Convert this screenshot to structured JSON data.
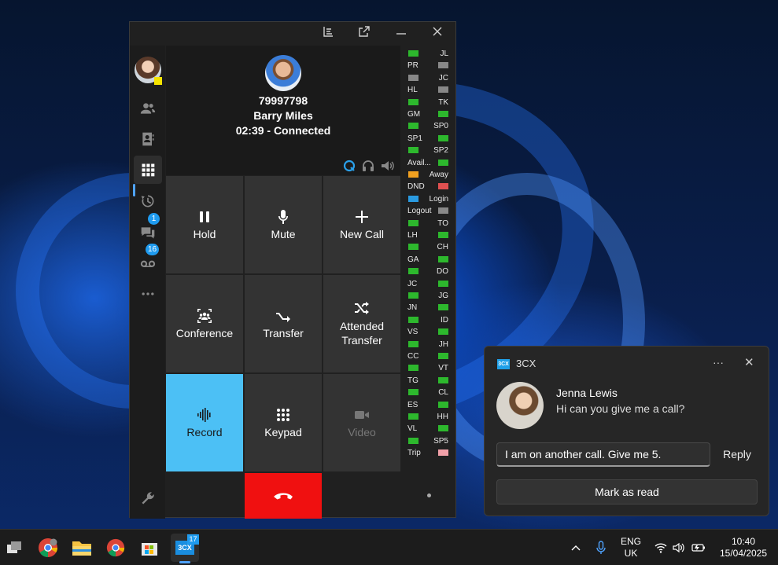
{
  "app": {
    "name": "3CX"
  },
  "call": {
    "number": "79997798",
    "name": "Barry Miles",
    "status": "02:39 - Connected"
  },
  "keys": [
    {
      "label": "Hold",
      "icon": "pause-icon"
    },
    {
      "label": "Mute",
      "icon": "microphone-icon"
    },
    {
      "label": "New Call",
      "icon": "plus-icon"
    },
    {
      "label": "Conference",
      "icon": "conference-icon"
    },
    {
      "label": "Transfer",
      "icon": "transfer-icon"
    },
    {
      "label": "Attended Transfer",
      "icon": "shuffle-icon"
    },
    {
      "label": "Record",
      "icon": "waveform-icon",
      "active": true
    },
    {
      "label": "Keypad",
      "icon": "keypad-icon"
    },
    {
      "label": "Video",
      "icon": "video-icon",
      "disabled": true
    }
  ],
  "sidebar": {
    "chat_badge": "1",
    "voicemail_badge": "16"
  },
  "blf": [
    {
      "label": "JL",
      "side": "right",
      "color": "#2db82d"
    },
    {
      "label": "PR",
      "side": "left",
      "color": "#888888"
    },
    {
      "label": "JC",
      "side": "right",
      "color": "#888888"
    },
    {
      "label": "HL",
      "side": "left",
      "color": "#888888"
    },
    {
      "label": "TK",
      "side": "right",
      "color": "#2db82d"
    },
    {
      "label": "GM",
      "side": "left",
      "color": "#2db82d"
    },
    {
      "label": "SP0",
      "side": "right",
      "color": "#2db82d"
    },
    {
      "label": "SP1",
      "side": "left",
      "color": "#2db82d"
    },
    {
      "label": "SP2",
      "side": "right",
      "color": "#2db82d"
    },
    {
      "label": "Avail...",
      "side": "left",
      "color": "#2db82d"
    },
    {
      "label": "Away",
      "side": "right",
      "color": "#f0a020"
    },
    {
      "label": "DND",
      "side": "left",
      "color": "#e05050"
    },
    {
      "label": "Login",
      "side": "right",
      "color": "#2a9ae0"
    },
    {
      "label": "Logout",
      "side": "left",
      "color": "#888888"
    },
    {
      "label": "TO",
      "side": "right",
      "color": "#2db82d"
    },
    {
      "label": "LH",
      "side": "left",
      "color": "#2db82d"
    },
    {
      "label": "CH",
      "side": "right",
      "color": "#2db82d"
    },
    {
      "label": "GA",
      "side": "left",
      "color": "#2db82d"
    },
    {
      "label": "DO",
      "side": "right",
      "color": "#2db82d"
    },
    {
      "label": "JC",
      "side": "left",
      "color": "#2db82d"
    },
    {
      "label": "JG",
      "side": "right",
      "color": "#2db82d"
    },
    {
      "label": "JN",
      "side": "left",
      "color": "#2db82d"
    },
    {
      "label": "ID",
      "side": "right",
      "color": "#2db82d"
    },
    {
      "label": "VS",
      "side": "left",
      "color": "#2db82d"
    },
    {
      "label": "JH",
      "side": "right",
      "color": "#2db82d"
    },
    {
      "label": "CC",
      "side": "left",
      "color": "#2db82d"
    },
    {
      "label": "VT",
      "side": "right",
      "color": "#2db82d"
    },
    {
      "label": "TG",
      "side": "left",
      "color": "#2db82d"
    },
    {
      "label": "CL",
      "side": "right",
      "color": "#2db82d"
    },
    {
      "label": "ES",
      "side": "left",
      "color": "#2db82d"
    },
    {
      "label": "HH",
      "side": "right",
      "color": "#2db82d"
    },
    {
      "label": "VL",
      "side": "left",
      "color": "#2db82d"
    },
    {
      "label": "SP5",
      "side": "right",
      "color": "#2db82d"
    },
    {
      "label": "Trip",
      "side": "left",
      "color": "#f0a0a8"
    }
  ],
  "notification": {
    "app": "3CX",
    "logo_text": "3CX",
    "sender": "Jenna Lewis",
    "message": "Hi can you give me a call?",
    "reply_value": "I am on another call. Give me 5.",
    "reply_label": "Reply",
    "mark_read_label": "Mark as read"
  },
  "taskbar": {
    "language_line1": "ENG",
    "language_line2": "UK",
    "time": "10:40",
    "date": "15/04/2025",
    "app_badge": "17",
    "app_label": "3CX"
  }
}
